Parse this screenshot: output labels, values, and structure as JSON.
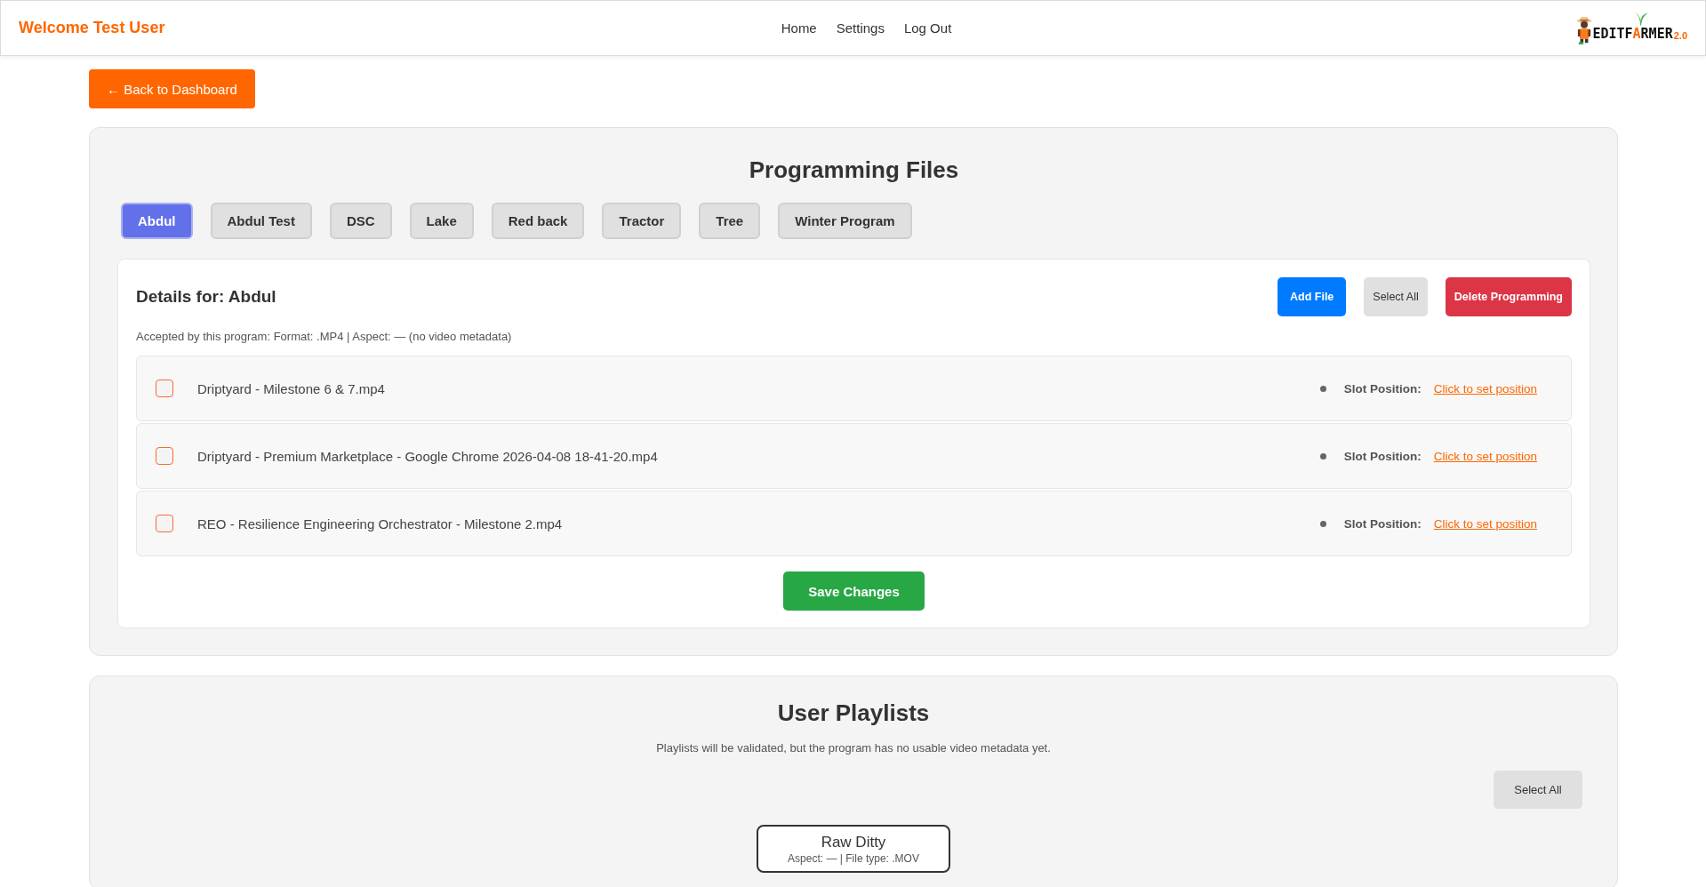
{
  "header": {
    "welcome": "Welcome Test User",
    "nav": [
      "Home",
      "Settings",
      "Log Out"
    ],
    "logo": {
      "parts": [
        {
          "text": "EDITF",
          "accent": false
        },
        {
          "text": "A",
          "accent": true
        },
        {
          "text": "RMER",
          "accent": false
        }
      ],
      "version": "2.0"
    }
  },
  "back_button": "← Back to Dashboard",
  "programming": {
    "title": "Programming Files",
    "tabs": [
      {
        "label": "Abdul",
        "selected": true
      },
      {
        "label": "Abdul Test",
        "selected": false
      },
      {
        "label": "DSC",
        "selected": false
      },
      {
        "label": "Lake",
        "selected": false
      },
      {
        "label": "Red back",
        "selected": false
      },
      {
        "label": "Tractor",
        "selected": false
      },
      {
        "label": "Tree",
        "selected": false
      },
      {
        "label": "Winter Program",
        "selected": false
      }
    ],
    "details": {
      "title": "Details for: Abdul",
      "buttons": [
        {
          "label": "Add File",
          "kind": "primary"
        },
        {
          "label": "Select All",
          "kind": "secondary"
        },
        {
          "label": "Delete Programming",
          "kind": "danger"
        }
      ],
      "accepted": "Accepted by this program: Format: .MP4 | Aspect: — (no video metadata)",
      "files": [
        {
          "name": "Driptyard - Milestone 6 & 7.mp4",
          "checked": false,
          "slot_label": "Slot Position:",
          "slot_link": "Click to set position"
        },
        {
          "name": "Driptyard - Premium Marketplace - Google Chrome 2026-04-08 18-41-20.mp4",
          "checked": false,
          "slot_label": "Slot Position:",
          "slot_link": "Click to set position"
        },
        {
          "name": "REO - Resilience Engineering Orchestrator - Milestone 2.mp4",
          "checked": false,
          "slot_label": "Slot Position:",
          "slot_link": "Click to set position"
        }
      ],
      "save": "Save Changes"
    }
  },
  "playlists": {
    "title": "User Playlists",
    "note": "Playlists will be validated, but the program has no usable video metadata yet.",
    "select_all": "Select All",
    "cards": [
      {
        "name": "Raw Ditty",
        "meta": "Aspect: — | File type: .MOV"
      }
    ]
  }
}
